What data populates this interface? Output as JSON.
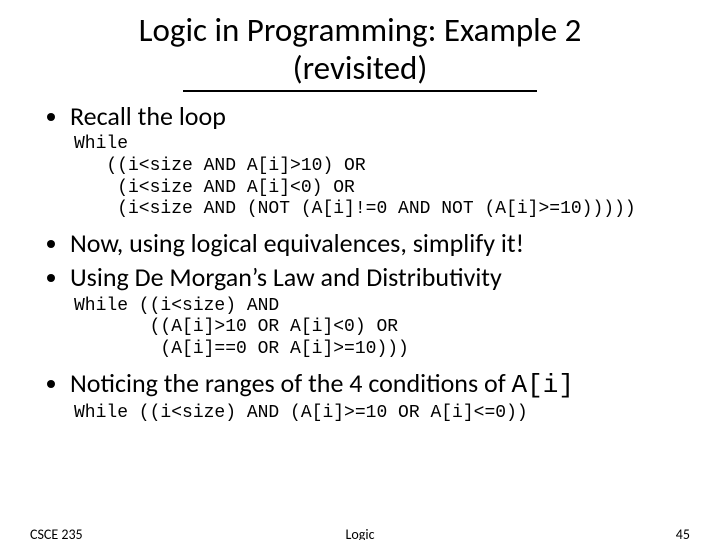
{
  "title": {
    "line1": "Logic in Programming: Example 2",
    "line2": "(revisited)"
  },
  "bullets": {
    "b1": "Recall the loop",
    "b2": "Now, using logical equivalences, simplify it!",
    "b3": "Using De Morgan’s Law and Distributivity",
    "b4_prefix": "Noticing the ranges of the 4 conditions of ",
    "b4_code": "A[i]"
  },
  "code": {
    "block1": "While\n   ((i<size AND A[i]>10) OR\n    (i<size AND A[i]<0) OR\n    (i<size AND (NOT (A[i]!=0 AND NOT (A[i]>=10)))))",
    "block2": "While ((i<size) AND\n       ((A[i]>10 OR A[i]<0) OR\n        (A[i]==0 OR A[i]>=10)))",
    "block3": "While ((i<size) AND (A[i]>=10 OR A[i]<=0))"
  },
  "footer": {
    "left": "CSCE 235",
    "center": "Logic",
    "right": "45"
  }
}
